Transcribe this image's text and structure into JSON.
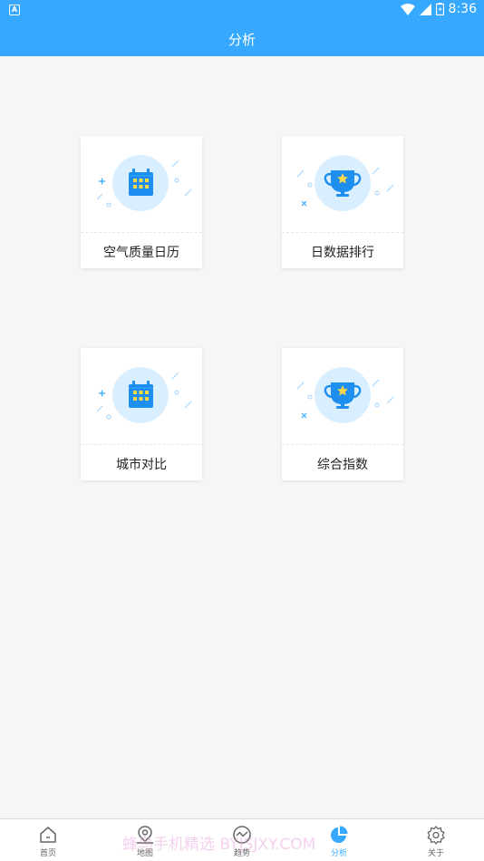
{
  "status_bar": {
    "time": "8:36",
    "left_icon": "A"
  },
  "header": {
    "title": "分析"
  },
  "cards": [
    {
      "label": "空气质量日历",
      "icon": "calendar-icon"
    },
    {
      "label": "日数据排行",
      "icon": "trophy-icon"
    },
    {
      "label": "城市对比",
      "icon": "calendar-icon"
    },
    {
      "label": "综合指数",
      "icon": "trophy-icon"
    }
  ],
  "bottom_nav": {
    "items": [
      {
        "label": "首页",
        "icon": "home-icon"
      },
      {
        "label": "地图",
        "icon": "map-pin-icon"
      },
      {
        "label": "趋势",
        "icon": "trend-icon"
      },
      {
        "label": "分析",
        "icon": "pie-chart-icon",
        "active": true
      },
      {
        "label": "关于",
        "icon": "gear-icon"
      }
    ]
  },
  "watermark": "蜂鸟手机精选 BYJSJXY.COM",
  "colors": {
    "accent": "#36a8ff",
    "icon_blue": "#1e8ef0",
    "icon_circle": "#d9efff",
    "star_yellow": "#ffd84a"
  }
}
